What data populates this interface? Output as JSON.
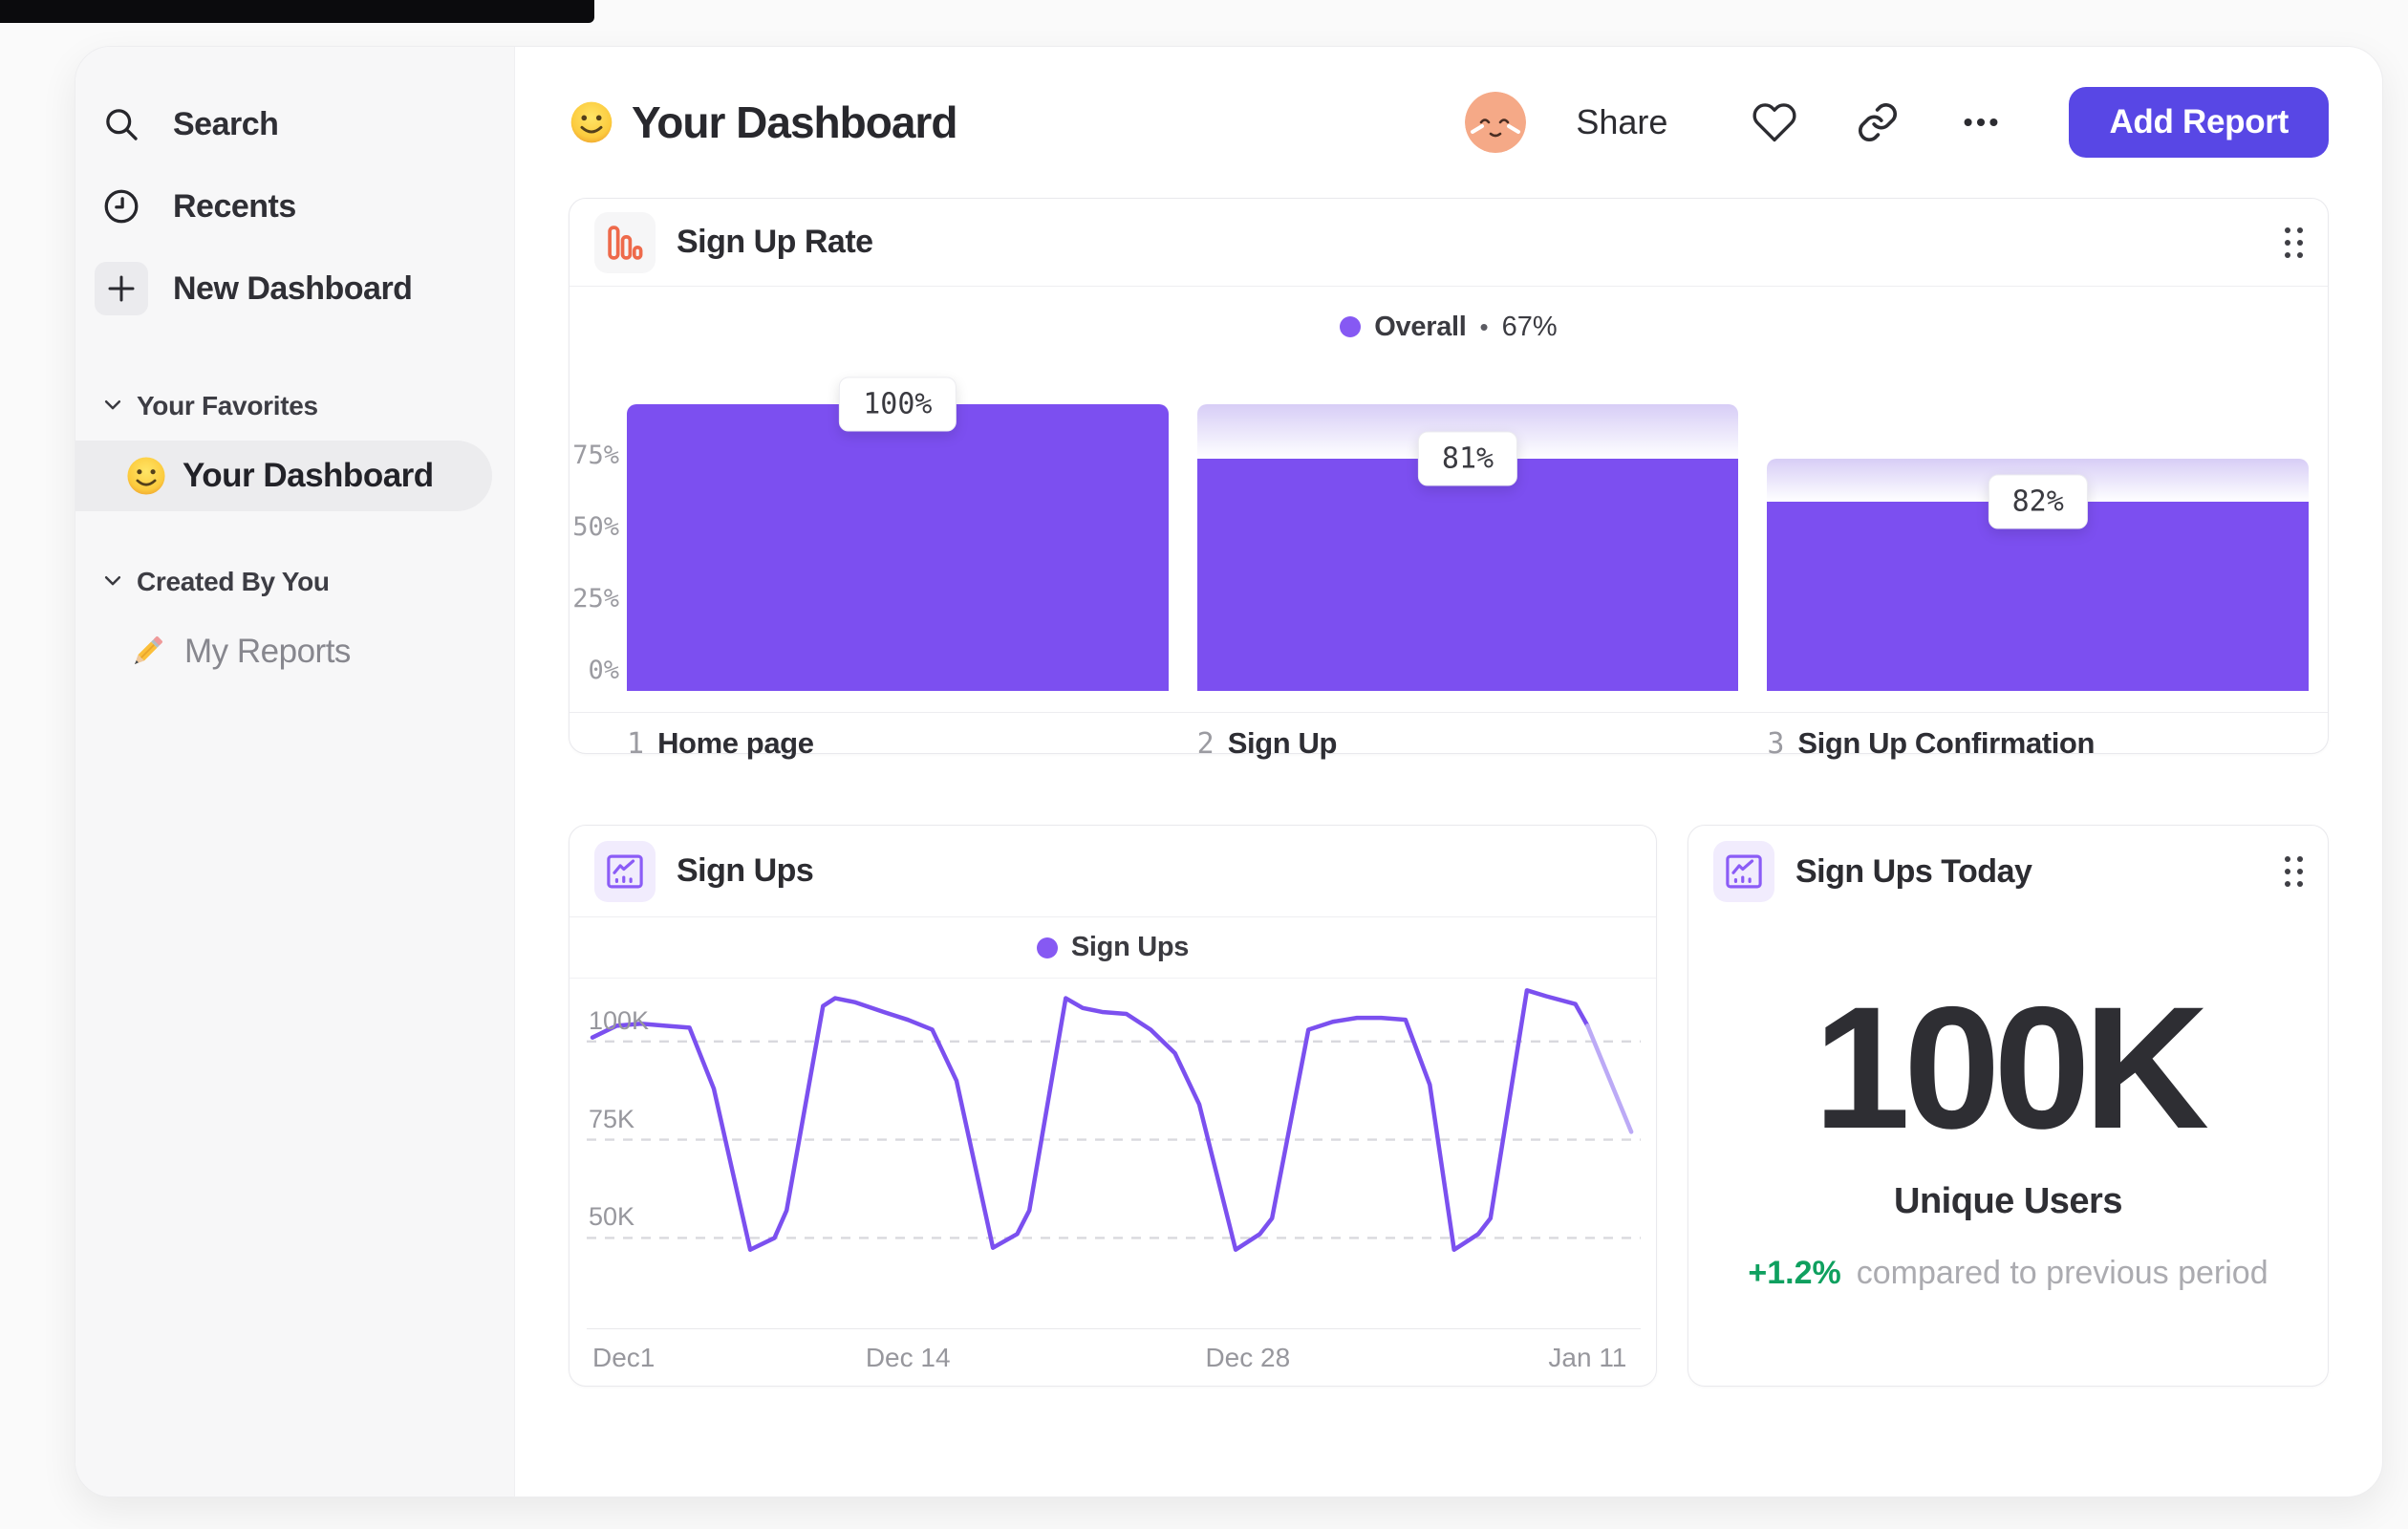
{
  "sidebar": {
    "nav": [
      {
        "label": "Search",
        "icon": "search-icon"
      },
      {
        "label": "Recents",
        "icon": "clock-icon"
      },
      {
        "label": "New Dashboard",
        "icon": "plus-icon"
      }
    ],
    "sections": [
      {
        "label": "Your Favorites",
        "items": [
          {
            "label": "Your Dashboard",
            "emoji": "smiley-face",
            "active": true
          }
        ]
      },
      {
        "label": "Created By You",
        "items": [
          {
            "label": "My Reports",
            "emoji": "pencil",
            "active": false
          }
        ]
      }
    ]
  },
  "header": {
    "title": "Your Dashboard",
    "share_label": "Share",
    "add_report_label": "Add Report",
    "action_icons": [
      "heart-icon",
      "link-icon",
      "more-options-icon"
    ]
  },
  "cards": {
    "funnel": {
      "title": "Sign Up Rate",
      "legend_series": "Overall",
      "legend_sep": "•",
      "legend_value": "67%"
    },
    "line": {
      "title": "Sign Ups",
      "legend_series": "Sign Ups"
    },
    "stat": {
      "title": "Sign Ups Today",
      "value": "100K",
      "label": "Unique Users",
      "delta": "+1.2%",
      "delta_note": "compared to previous period"
    }
  },
  "chart_data": [
    {
      "type": "bar",
      "subtype": "funnel",
      "title": "Sign Up Rate",
      "categories": [
        "Home page",
        "Sign Up",
        "Sign Up Confirmation"
      ],
      "step_numbers": [
        "1",
        "2",
        "3"
      ],
      "step_conversion_pct": [
        100,
        81,
        82
      ],
      "cumulative_pct": [
        100,
        81,
        66
      ],
      "tooltips": [
        "100%",
        "81%",
        "82%"
      ],
      "overall_conversion": "67%",
      "yticks": [
        {
          "label": "75%",
          "value": 75
        },
        {
          "label": "50%",
          "value": 50
        },
        {
          "label": "25%",
          "value": 25
        },
        {
          "label": "0%",
          "value": 0
        }
      ],
      "ylim": [
        0,
        115
      ],
      "bar_color": "#7c4ff0",
      "fade_top_color": "#d7cdf6",
      "legend_position": "top-center",
      "grid": "off"
    },
    {
      "type": "line",
      "title": "Sign Ups",
      "series": [
        {
          "name": "Sign Ups",
          "color": "#7b50ef",
          "x_days": [
            0,
            1,
            2,
            3,
            4,
            5,
            6.5,
            7.5,
            8,
            9.5,
            10,
            10.8,
            12,
            13,
            14,
            15,
            16.5,
            17.5,
            18,
            19.5,
            20.2,
            21,
            22,
            23,
            24,
            25,
            26.5,
            27.5,
            28,
            29.5,
            30.5,
            31.5,
            32.5,
            33.5,
            34.5,
            35.5,
            36.5,
            37,
            38.5,
            39.3,
            40.5,
            41,
            42.8
          ],
          "values_k": [
            101,
            104,
            104.5,
            104,
            103.5,
            88,
            47,
            50,
            57,
            109,
            111,
            110,
            107.5,
            105.5,
            103,
            90,
            47.5,
            51,
            57,
            111,
            108.5,
            107.5,
            107,
            103,
            97,
            84,
            47,
            51,
            55,
            103,
            105,
            106,
            106,
            105.5,
            89,
            47,
            51,
            55,
            113,
            111.5,
            109.5,
            104,
            77
          ]
        }
      ],
      "x_ticks": [
        {
          "label": "Dec1",
          "day": 0
        },
        {
          "label": "Dec 14",
          "day": 13
        },
        {
          "label": "Dec 28",
          "day": 27
        },
        {
          "label": "Jan 11",
          "day": 41
        }
      ],
      "y_ticks": [
        {
          "label": "100K",
          "value": 100
        },
        {
          "label": "75K",
          "value": 75
        },
        {
          "label": "50K",
          "value": 50
        }
      ],
      "ylim_k": [
        27,
        116
      ],
      "grid": "dashed-horizontal",
      "legend_position": "top-center",
      "final_segment_faded": true,
      "fade_color": "#bcaaf6"
    }
  ]
}
